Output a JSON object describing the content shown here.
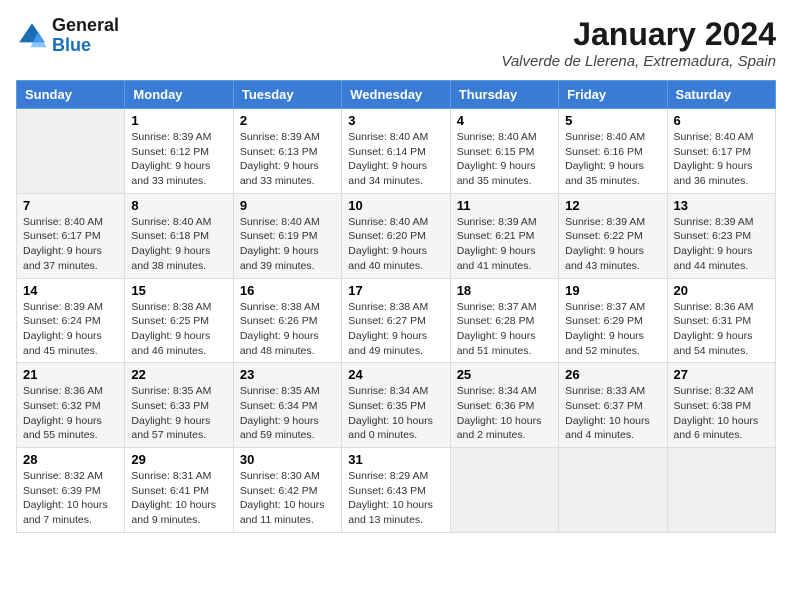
{
  "header": {
    "logo_line1": "General",
    "logo_line2": "Blue",
    "month": "January 2024",
    "location": "Valverde de Llerena, Extremadura, Spain"
  },
  "days_of_week": [
    "Sunday",
    "Monday",
    "Tuesday",
    "Wednesday",
    "Thursday",
    "Friday",
    "Saturday"
  ],
  "weeks": [
    [
      {
        "day": "",
        "content": ""
      },
      {
        "day": "1",
        "content": "Sunrise: 8:39 AM\nSunset: 6:12 PM\nDaylight: 9 hours\nand 33 minutes."
      },
      {
        "day": "2",
        "content": "Sunrise: 8:39 AM\nSunset: 6:13 PM\nDaylight: 9 hours\nand 33 minutes."
      },
      {
        "day": "3",
        "content": "Sunrise: 8:40 AM\nSunset: 6:14 PM\nDaylight: 9 hours\nand 34 minutes."
      },
      {
        "day": "4",
        "content": "Sunrise: 8:40 AM\nSunset: 6:15 PM\nDaylight: 9 hours\nand 35 minutes."
      },
      {
        "day": "5",
        "content": "Sunrise: 8:40 AM\nSunset: 6:16 PM\nDaylight: 9 hours\nand 35 minutes."
      },
      {
        "day": "6",
        "content": "Sunrise: 8:40 AM\nSunset: 6:17 PM\nDaylight: 9 hours\nand 36 minutes."
      }
    ],
    [
      {
        "day": "7",
        "content": "Sunrise: 8:40 AM\nSunset: 6:17 PM\nDaylight: 9 hours\nand 37 minutes."
      },
      {
        "day": "8",
        "content": "Sunrise: 8:40 AM\nSunset: 6:18 PM\nDaylight: 9 hours\nand 38 minutes."
      },
      {
        "day": "9",
        "content": "Sunrise: 8:40 AM\nSunset: 6:19 PM\nDaylight: 9 hours\nand 39 minutes."
      },
      {
        "day": "10",
        "content": "Sunrise: 8:40 AM\nSunset: 6:20 PM\nDaylight: 9 hours\nand 40 minutes."
      },
      {
        "day": "11",
        "content": "Sunrise: 8:39 AM\nSunset: 6:21 PM\nDaylight: 9 hours\nand 41 minutes."
      },
      {
        "day": "12",
        "content": "Sunrise: 8:39 AM\nSunset: 6:22 PM\nDaylight: 9 hours\nand 43 minutes."
      },
      {
        "day": "13",
        "content": "Sunrise: 8:39 AM\nSunset: 6:23 PM\nDaylight: 9 hours\nand 44 minutes."
      }
    ],
    [
      {
        "day": "14",
        "content": "Sunrise: 8:39 AM\nSunset: 6:24 PM\nDaylight: 9 hours\nand 45 minutes."
      },
      {
        "day": "15",
        "content": "Sunrise: 8:38 AM\nSunset: 6:25 PM\nDaylight: 9 hours\nand 46 minutes."
      },
      {
        "day": "16",
        "content": "Sunrise: 8:38 AM\nSunset: 6:26 PM\nDaylight: 9 hours\nand 48 minutes."
      },
      {
        "day": "17",
        "content": "Sunrise: 8:38 AM\nSunset: 6:27 PM\nDaylight: 9 hours\nand 49 minutes."
      },
      {
        "day": "18",
        "content": "Sunrise: 8:37 AM\nSunset: 6:28 PM\nDaylight: 9 hours\nand 51 minutes."
      },
      {
        "day": "19",
        "content": "Sunrise: 8:37 AM\nSunset: 6:29 PM\nDaylight: 9 hours\nand 52 minutes."
      },
      {
        "day": "20",
        "content": "Sunrise: 8:36 AM\nSunset: 6:31 PM\nDaylight: 9 hours\nand 54 minutes."
      }
    ],
    [
      {
        "day": "21",
        "content": "Sunrise: 8:36 AM\nSunset: 6:32 PM\nDaylight: 9 hours\nand 55 minutes."
      },
      {
        "day": "22",
        "content": "Sunrise: 8:35 AM\nSunset: 6:33 PM\nDaylight: 9 hours\nand 57 minutes."
      },
      {
        "day": "23",
        "content": "Sunrise: 8:35 AM\nSunset: 6:34 PM\nDaylight: 9 hours\nand 59 minutes."
      },
      {
        "day": "24",
        "content": "Sunrise: 8:34 AM\nSunset: 6:35 PM\nDaylight: 10 hours\nand 0 minutes."
      },
      {
        "day": "25",
        "content": "Sunrise: 8:34 AM\nSunset: 6:36 PM\nDaylight: 10 hours\nand 2 minutes."
      },
      {
        "day": "26",
        "content": "Sunrise: 8:33 AM\nSunset: 6:37 PM\nDaylight: 10 hours\nand 4 minutes."
      },
      {
        "day": "27",
        "content": "Sunrise: 8:32 AM\nSunset: 6:38 PM\nDaylight: 10 hours\nand 6 minutes."
      }
    ],
    [
      {
        "day": "28",
        "content": "Sunrise: 8:32 AM\nSunset: 6:39 PM\nDaylight: 10 hours\nand 7 minutes."
      },
      {
        "day": "29",
        "content": "Sunrise: 8:31 AM\nSunset: 6:41 PM\nDaylight: 10 hours\nand 9 minutes."
      },
      {
        "day": "30",
        "content": "Sunrise: 8:30 AM\nSunset: 6:42 PM\nDaylight: 10 hours\nand 11 minutes."
      },
      {
        "day": "31",
        "content": "Sunrise: 8:29 AM\nSunset: 6:43 PM\nDaylight: 10 hours\nand 13 minutes."
      },
      {
        "day": "",
        "content": ""
      },
      {
        "day": "",
        "content": ""
      },
      {
        "day": "",
        "content": ""
      }
    ]
  ]
}
